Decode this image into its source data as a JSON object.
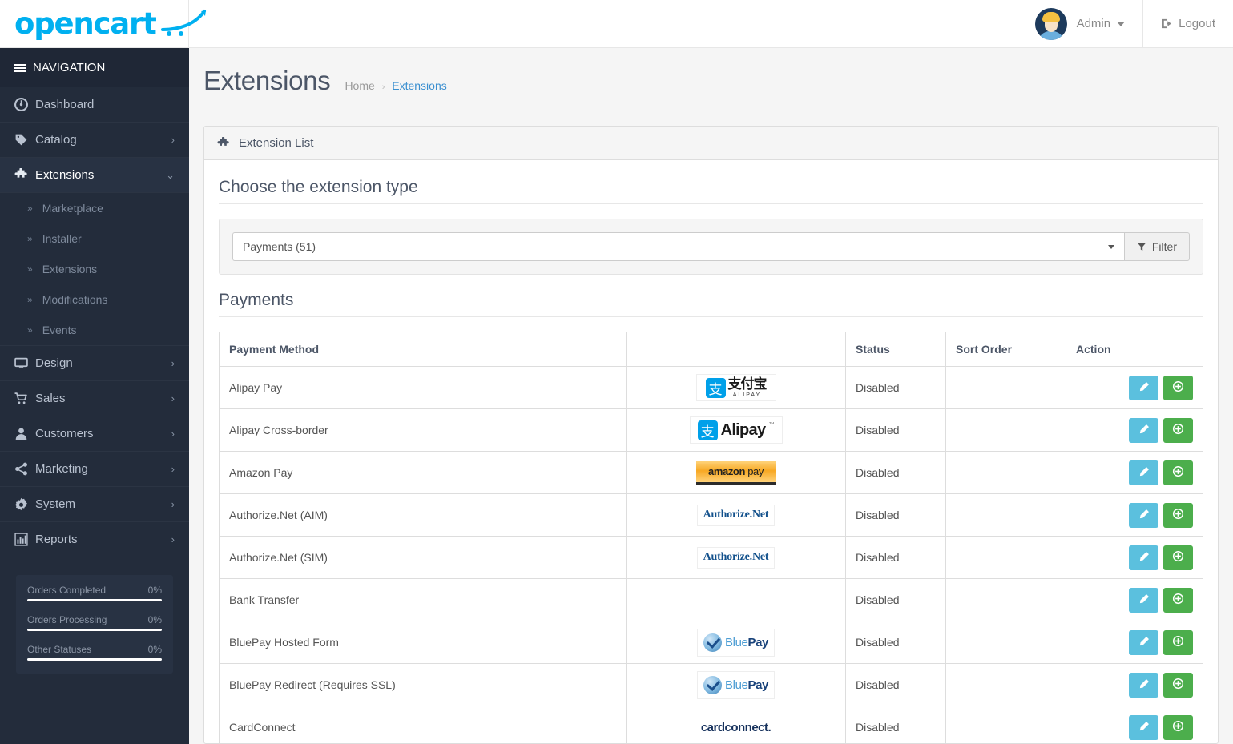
{
  "brand": {
    "name": "opencart"
  },
  "topbar": {
    "user_label": "Admin",
    "logout_label": "Logout"
  },
  "sidebar": {
    "nav_title": "NAVIGATION",
    "items": [
      {
        "label": "Dashboard",
        "icon": "dashboard-icon",
        "arrow": "",
        "active": false
      },
      {
        "label": "Catalog",
        "icon": "tag-icon",
        "arrow": "›",
        "active": false
      },
      {
        "label": "Extensions",
        "icon": "puzzle-icon",
        "arrow": "⌄",
        "active": true
      }
    ],
    "sub_items": [
      {
        "label": "Marketplace"
      },
      {
        "label": "Installer"
      },
      {
        "label": "Extensions"
      },
      {
        "label": "Modifications"
      },
      {
        "label": "Events"
      }
    ],
    "items_after": [
      {
        "label": "Design",
        "icon": "monitor-icon",
        "arrow": "›"
      },
      {
        "label": "Sales",
        "icon": "cart-icon",
        "arrow": "›"
      },
      {
        "label": "Customers",
        "icon": "user-icon",
        "arrow": "›"
      },
      {
        "label": "Marketing",
        "icon": "share-icon",
        "arrow": "›"
      },
      {
        "label": "System",
        "icon": "gear-icon",
        "arrow": "›"
      },
      {
        "label": "Reports",
        "icon": "bar-chart-icon",
        "arrow": "›"
      }
    ],
    "stats": [
      {
        "label": "Orders Completed",
        "value": "0%",
        "percent": 0
      },
      {
        "label": "Orders Processing",
        "value": "0%",
        "percent": 0
      },
      {
        "label": "Other Statuses",
        "value": "0%",
        "percent": 0
      }
    ]
  },
  "page": {
    "title": "Extensions",
    "breadcrumb": {
      "home": "Home",
      "separator": "›",
      "current": "Extensions"
    },
    "panel_title": "Extension List",
    "choose_heading": "Choose the extension type",
    "filter": {
      "selected": "Payments (51)",
      "button_label": "Filter"
    },
    "section_heading": "Payments"
  },
  "table": {
    "headers": {
      "method": "Payment Method",
      "logo": "",
      "status": "Status",
      "sort_order": "Sort Order",
      "action": "Action"
    },
    "rows": [
      {
        "method": "Alipay Pay",
        "logo": "alipay-cn",
        "status": "Disabled",
        "sort_order": ""
      },
      {
        "method": "Alipay Cross-border",
        "logo": "alipay-en",
        "status": "Disabled",
        "sort_order": ""
      },
      {
        "method": "Amazon Pay",
        "logo": "amazon-pay",
        "status": "Disabled",
        "sort_order": ""
      },
      {
        "method": "Authorize.Net (AIM)",
        "logo": "authorize-net",
        "status": "Disabled",
        "sort_order": ""
      },
      {
        "method": "Authorize.Net (SIM)",
        "logo": "authorize-net",
        "status": "Disabled",
        "sort_order": ""
      },
      {
        "method": "Bank Transfer",
        "logo": "",
        "status": "Disabled",
        "sort_order": ""
      },
      {
        "method": "BluePay Hosted Form",
        "logo": "bluepay",
        "status": "Disabled",
        "sort_order": ""
      },
      {
        "method": "BluePay Redirect (Requires SSL)",
        "logo": "bluepay",
        "status": "Disabled",
        "sort_order": ""
      },
      {
        "method": "CardConnect",
        "logo": "cardconnect",
        "status": "Disabled",
        "sort_order": ""
      }
    ]
  },
  "logo_text": {
    "alipay_cn_mark": "支",
    "alipay_cn_word": "支付宝",
    "alipay_cn_sub": "ALIPAY",
    "alipay_en_word": "Alipay",
    "alipay_en_tm": "™",
    "amazon_word_1": "amazon",
    "amazon_word_2": "pay",
    "authorize_word": "Authorize.Net",
    "bluepay_light": "Blue",
    "bluepay_dark": "Pay",
    "cardconnect_word_1": "card",
    "cardconnect_word_2": "connect",
    "cardconnect_dot": "."
  },
  "colors": {
    "accent": "#00b0f0",
    "sidebar": "#232c3b",
    "edit_button": "#5bc0de",
    "install_button": "#4cae4c",
    "breadcrumb_link": "#3a8fd0"
  }
}
